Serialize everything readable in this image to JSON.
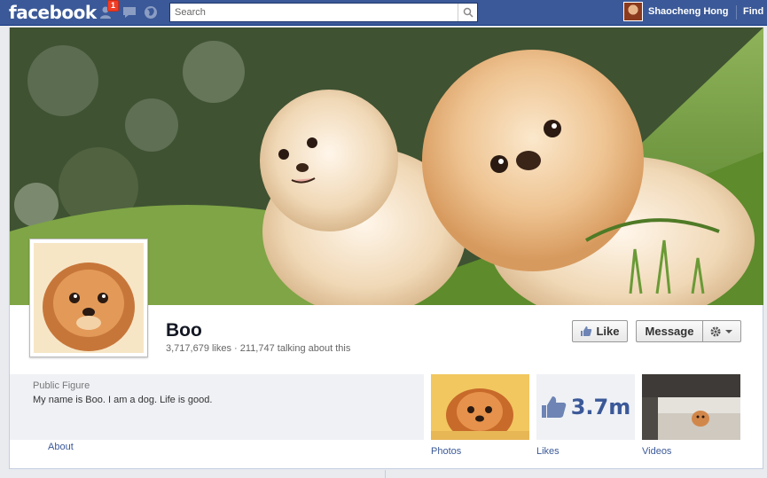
{
  "topbar": {
    "logo": "facebook",
    "notification_count": "1",
    "search_placeholder": "Search",
    "user_name": "Shaocheng Hong",
    "find_label": "Find"
  },
  "page": {
    "name": "Boo",
    "stats": "3,717,679 likes · 211,747 talking about this",
    "like_button": "Like",
    "message_button": "Message",
    "category": "Public Figure",
    "about_text": "My name is Boo. I am a dog. Life is good.",
    "about_link": "About"
  },
  "apps": [
    {
      "label": "Photos"
    },
    {
      "label": "Likes",
      "value": "3.7m"
    },
    {
      "label": "Videos"
    }
  ],
  "colors": {
    "brand": "#3b5998",
    "badge": "#f03d25"
  }
}
